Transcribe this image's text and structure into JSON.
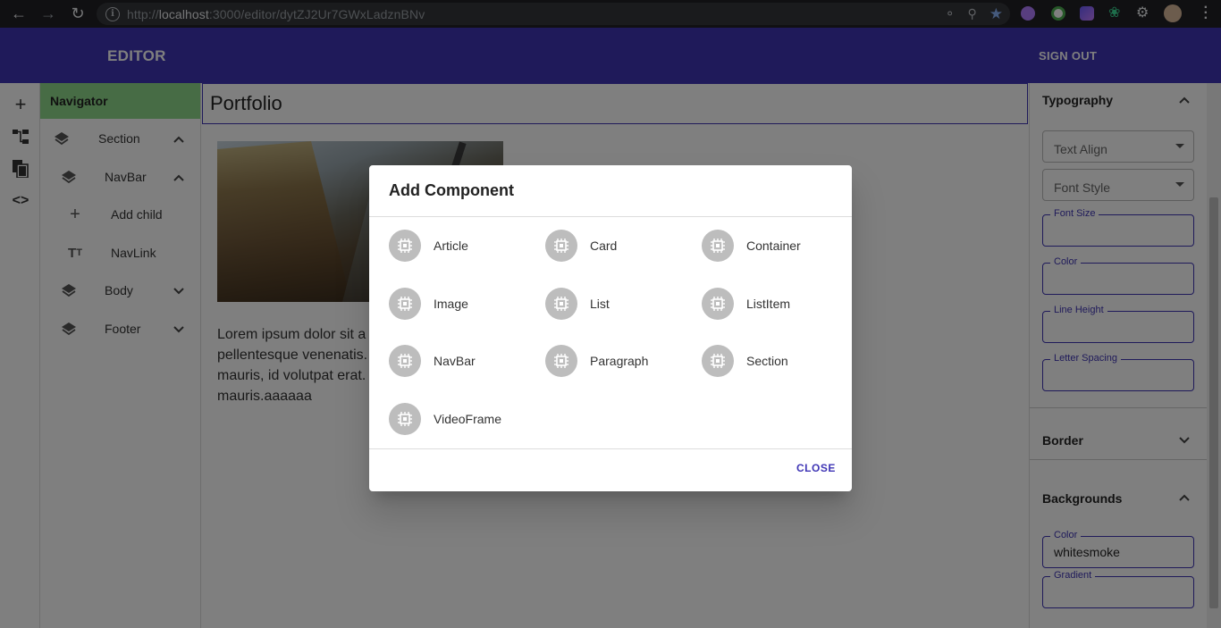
{
  "browser": {
    "url_prefix": "http://",
    "url_host": "localhost",
    "url_path": ":3000/editor/dytZJ2Ur7GWxLadznBNv"
  },
  "appbar": {
    "title": "EDITOR",
    "signout_label": "SIGN OUT",
    "color": "#3f35b5"
  },
  "navigator": {
    "title": "Navigator",
    "items": [
      {
        "label": "Section",
        "icon": "layers-icon"
      },
      {
        "label": "NavBar",
        "icon": "layers-icon"
      },
      {
        "label": "Add child",
        "icon": "plus-icon"
      },
      {
        "label": "NavLink",
        "icon": "text-fields-icon"
      },
      {
        "label": "Body",
        "icon": "layers-icon"
      },
      {
        "label": "Footer",
        "icon": "layers-icon"
      }
    ]
  },
  "canvas": {
    "heading": "Portfolio",
    "lorem_lines": [
      "Lorem ipsum dolor sit a",
      "pellentesque venenatis.",
      "mauris, id volutpat erat.",
      "mauris.aaaaaa"
    ]
  },
  "panel": {
    "typography_title": "Typography",
    "text_align_label": "Text Align",
    "font_style_label": "Font Style",
    "font_size_label": "Font Size",
    "color_label": "Color",
    "line_height_label": "Line Height",
    "letter_spacing_label": "Letter Spacing",
    "border_title": "Border",
    "backgrounds_title": "Backgrounds",
    "bg_color_label": "Color",
    "bg_color_value": "whitesmoke",
    "gradient_label": "Gradient"
  },
  "dialog": {
    "title": "Add Component",
    "components": [
      "Article",
      "Card",
      "Container",
      "Image",
      "List",
      "ListItem",
      "NavBar",
      "Paragraph",
      "Section",
      "VideoFrame"
    ],
    "close_label": "CLOSE"
  }
}
